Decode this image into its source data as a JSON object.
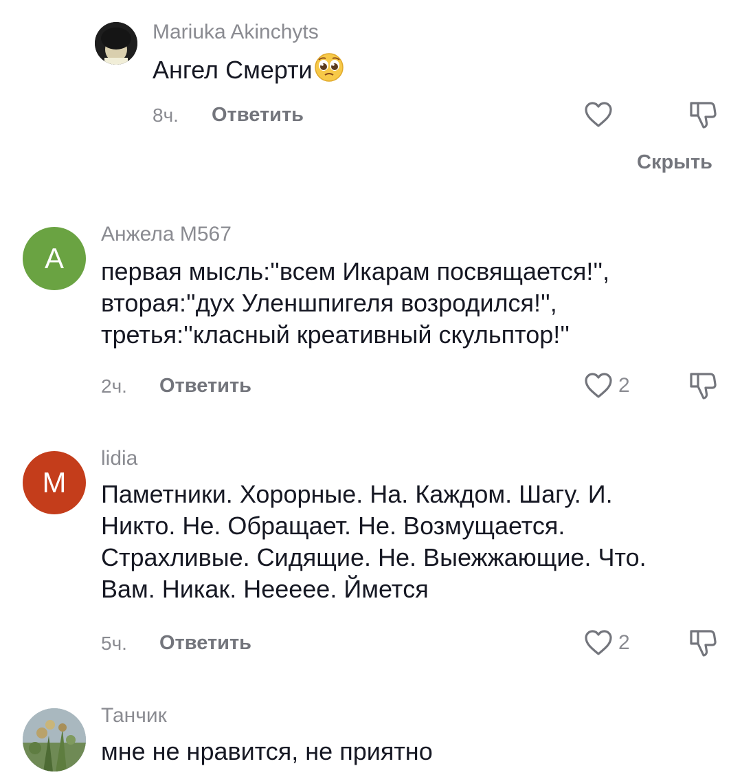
{
  "comments": [
    {
      "author": "Mariuka Akinchyts",
      "text_lines": [
        "Ангел Смерти"
      ],
      "emoji": "pleading-face",
      "time": "8ч.",
      "reply_label": "Ответить",
      "like_count": "",
      "hide_label": "Скрыть"
    },
    {
      "author": "Анжела М567",
      "avatar_letter": "A",
      "avatar_color": "#6aa342",
      "text_lines": [
        "первая мысль:''всем Икарам посвящается!'',",
        "вторая:''дух Уленшпигеля возродился!'',",
        "третья:''класный креативный скульптор!''"
      ],
      "time": "2ч.",
      "reply_label": "Ответить",
      "like_count": "2"
    },
    {
      "author": "lidia",
      "avatar_letter": "M",
      "avatar_color": "#c43d1b",
      "text_lines": [
        "Паметники. Хорорные. На. Каждом. Шагу. И.",
        "Никто. Не. Обращает. Не. Возмущается.",
        "Страхливые. Сидящие. Не. Выежжающие. Что.",
        "Вам. Никак. Нееееe. Йметcя"
      ],
      "time": "5ч.",
      "reply_label": "Ответить",
      "like_count": "2"
    },
    {
      "author": "Танчик",
      "text_lines": [
        "мне не нравится, не приятно"
      ]
    }
  ]
}
